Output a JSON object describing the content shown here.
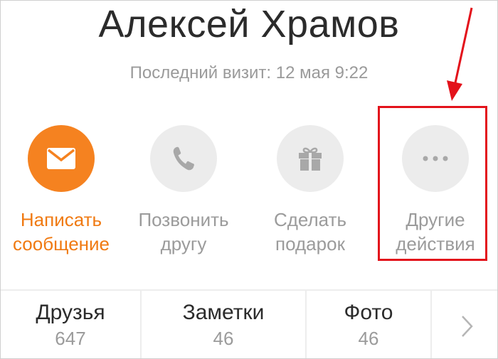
{
  "profile": {
    "name": "Алексей Храмов",
    "last_visit": "Последний визит: 12 мая 9:22"
  },
  "actions": [
    {
      "icon": "envelope-icon",
      "line1": "Написать",
      "line2": "сообщение",
      "primary": true
    },
    {
      "icon": "phone-icon",
      "line1": "Позвонить",
      "line2": "другу",
      "primary": false
    },
    {
      "icon": "gift-icon",
      "line1": "Сделать",
      "line2": "подарок",
      "primary": false
    },
    {
      "icon": "more-dots-icon",
      "line1": "Другие",
      "line2": "действия",
      "primary": false
    }
  ],
  "stats": [
    {
      "title": "Друзья",
      "count": "647"
    },
    {
      "title": "Заметки",
      "count": "46"
    },
    {
      "title": "Фото",
      "count": "46"
    }
  ],
  "colors": {
    "accent": "#f58220",
    "accent_text": "#f07a12",
    "icon_bg": "#ececec",
    "icon_gray": "#a8a8a8",
    "annotation_red": "#e3121b"
  }
}
